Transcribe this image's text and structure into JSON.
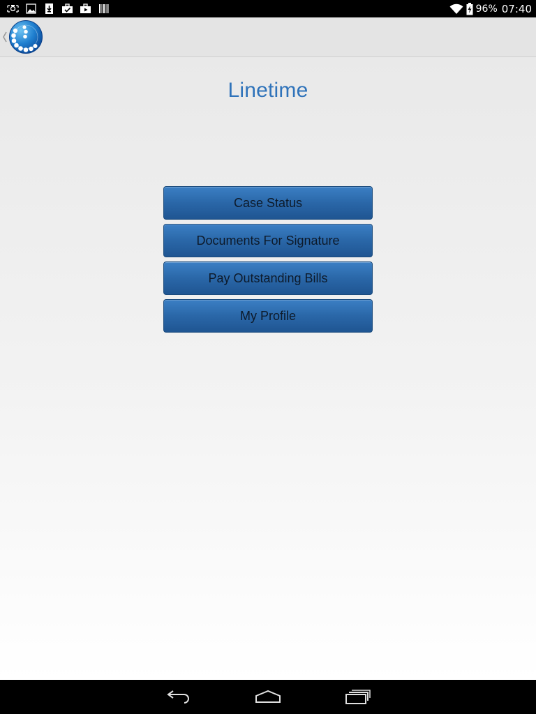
{
  "status_bar": {
    "battery": "96%",
    "time": "07:40",
    "left_icons": [
      "screenshot-icon",
      "image-icon",
      "download-icon",
      "briefcase-check-icon",
      "briefcase-play-icon",
      "barcode-icon"
    ],
    "right_icons": [
      "wifi-icon",
      "battery-charging-icon"
    ]
  },
  "action_bar": {
    "logo_icon": "app-globe-logo",
    "back_icon": "chevron-left-icon"
  },
  "main": {
    "title": "Linetime",
    "title_color": "#2f73ba",
    "buttons": [
      {
        "label": "Case Status"
      },
      {
        "label": "Documents For Signature"
      },
      {
        "label": "Pay Outstanding Bills"
      },
      {
        "label": "My Profile"
      }
    ],
    "button_color": "#2a67a8"
  },
  "nav_bar": {
    "icons": [
      "back-arrow-icon",
      "home-icon",
      "recent-apps-icon"
    ]
  }
}
